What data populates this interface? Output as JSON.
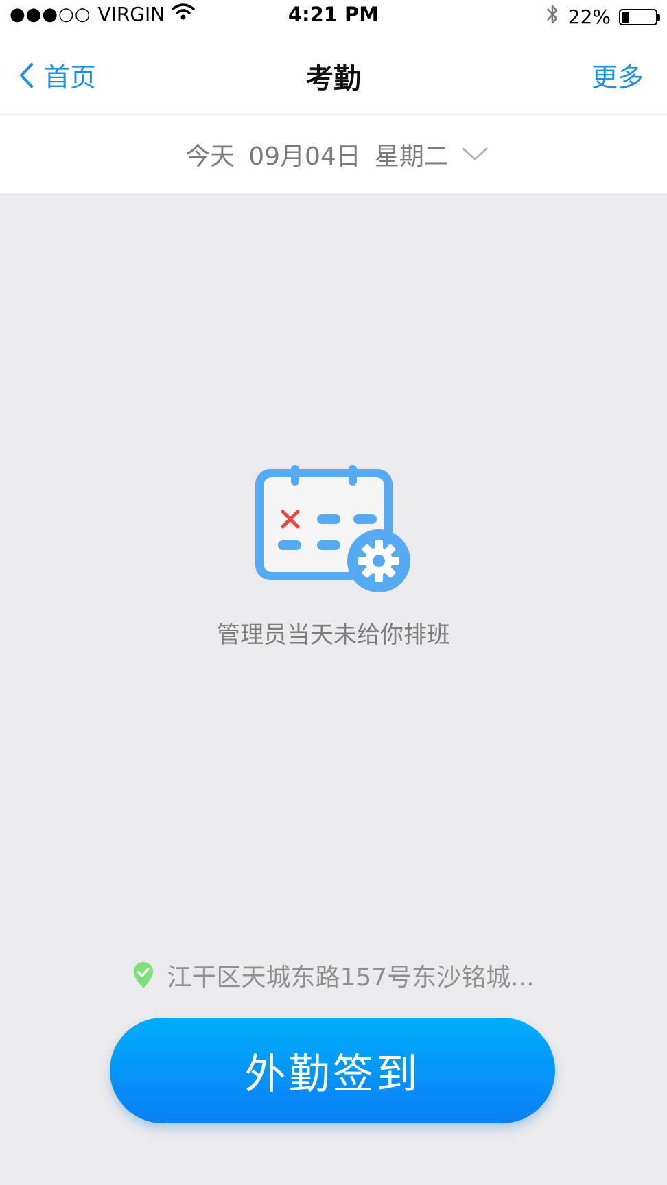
{
  "status_bar": {
    "signal": "●●●○○",
    "carrier": "VIRGIN",
    "time": "4:21 PM",
    "battery": "22%",
    "battery_level": 0.22
  },
  "nav": {
    "back_label": "首页",
    "title": "考勤",
    "more_label": "更多"
  },
  "date_selector": {
    "day_label": "今天",
    "date": "09月04日",
    "weekday": "星期二"
  },
  "empty_state": {
    "message": "管理员当天未给你排班"
  },
  "location": {
    "address": "江干区天城东路157号东沙铭城..."
  },
  "checkin": {
    "label": "外勤签到"
  },
  "colors": {
    "accent": "#1b8fe6",
    "button_top": "#00adfc",
    "button_bottom": "#0a7ff5",
    "background": "#ebebed",
    "icon_blue": "#55aaf2",
    "icon_red": "#e84545",
    "location_green": "#7ee07a"
  }
}
